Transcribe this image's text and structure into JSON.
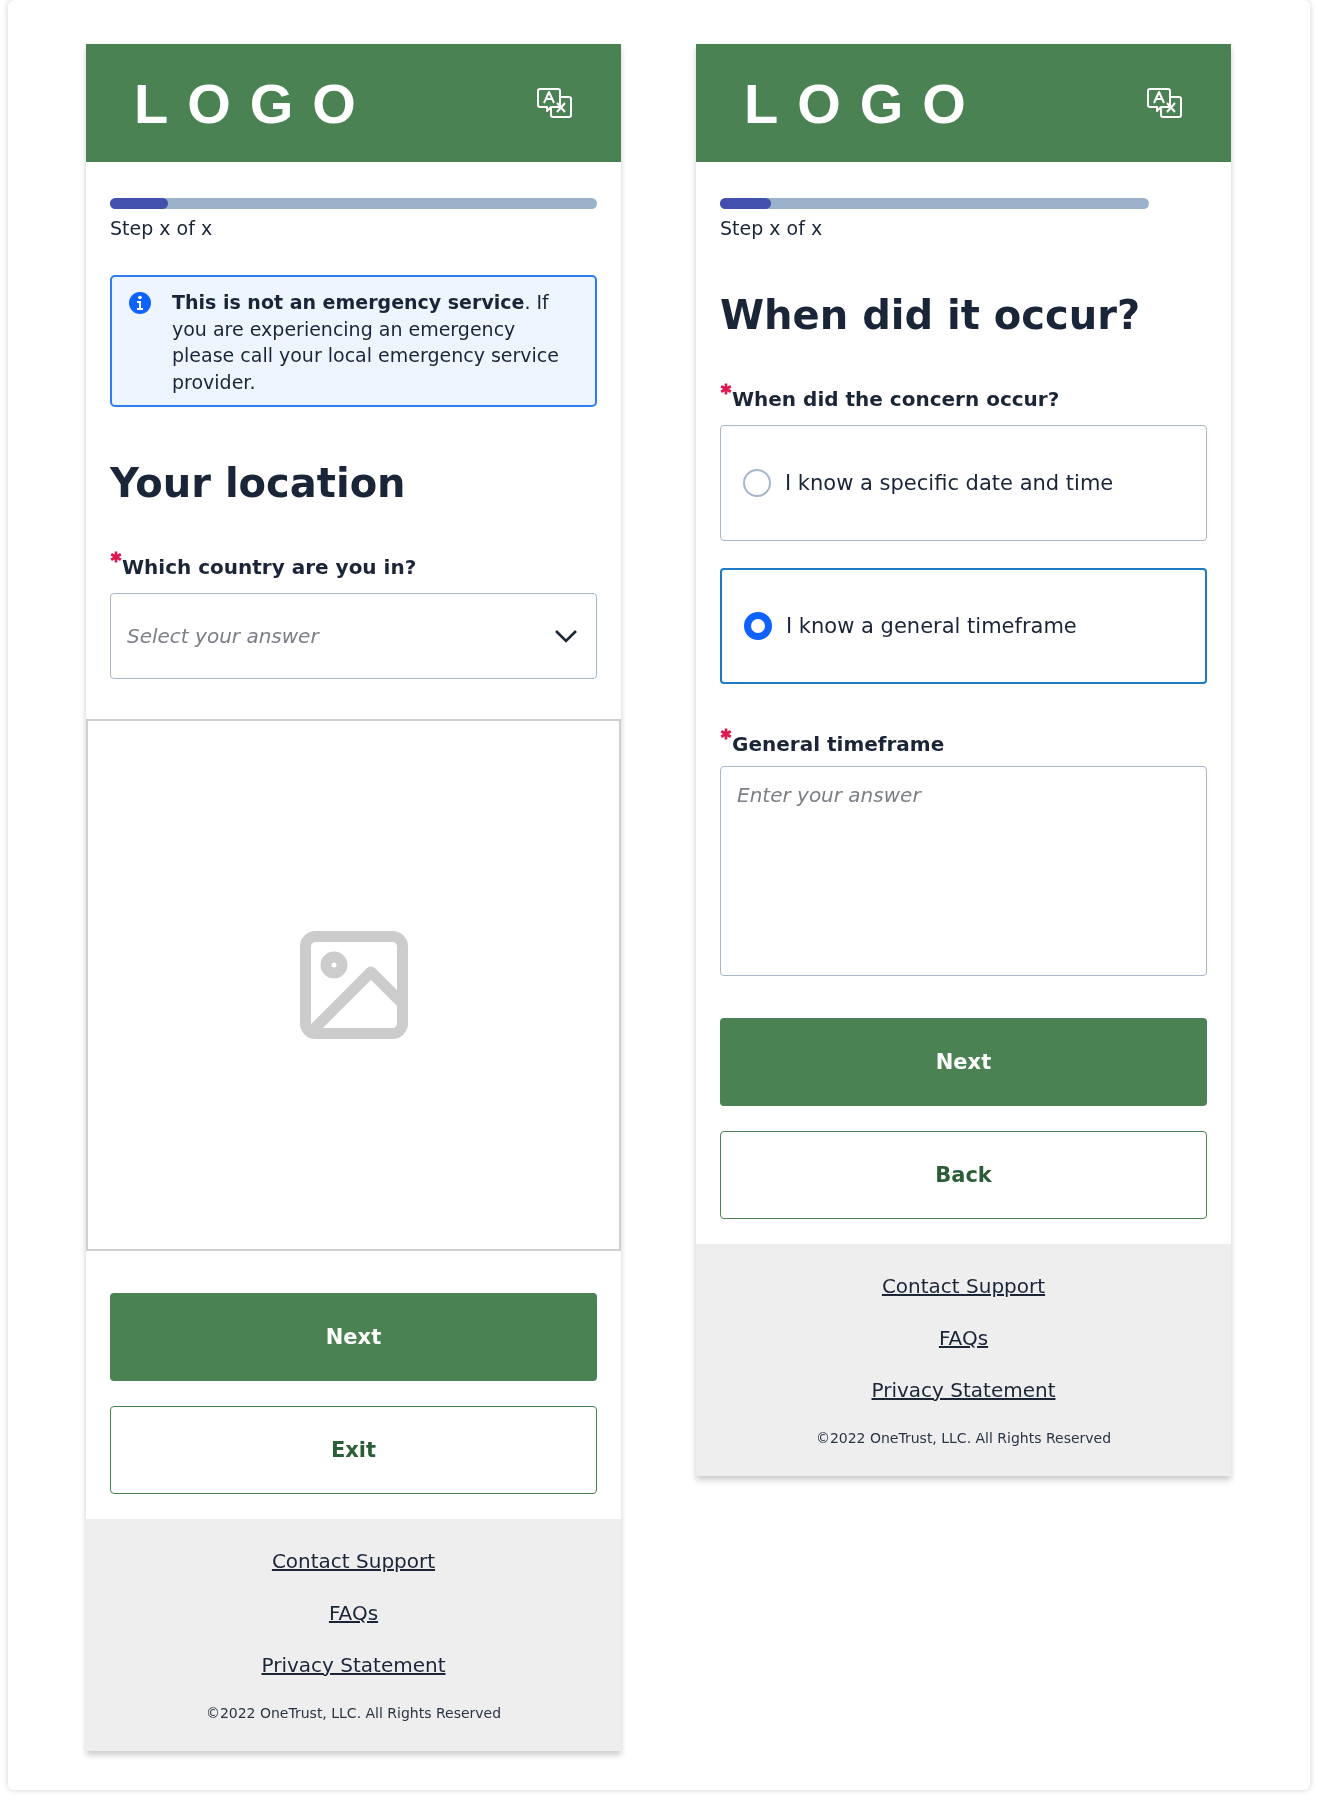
{
  "screens": [
    {
      "header": {
        "logo": "LOGO"
      },
      "progress": {
        "level": 0.12,
        "label": "Step x of x"
      },
      "blocks": [
        {
          "kind": "notice",
          "text": "**This is not an emergency service**. If you are experiencing an emergency please call your local emergency service provider."
        },
        {
          "kind": "heading",
          "text": "Your location"
        },
        {
          "kind": "select",
          "label": "Which country are you in?",
          "required": true,
          "placeholder": "Select your answer"
        },
        {
          "kind": "image"
        }
      ],
      "buttons": [
        {
          "label": "Next",
          "kind": "primary"
        },
        {
          "label": "Exit",
          "kind": "secondary"
        }
      ],
      "footer": {
        "links": [
          "Contact Support",
          "FAQs",
          "Privacy Statement"
        ],
        "copyright": "©2022 OneTrust, LLC. All Rights Reserved"
      }
    },
    {
      "header": {
        "logo": "LOGO"
      },
      "progress": {
        "level": 0.12,
        "label": "Step x of x"
      },
      "blocks": [
        {
          "kind": "heading",
          "text": "When did it occur?"
        },
        {
          "kind": "radio",
          "label": "When did the concern occur?",
          "required": true,
          "options": [
            {
              "label": "I know a specific date and time",
              "selected": false
            },
            {
              "label": "I know a general timeframe",
              "selected": true
            }
          ]
        },
        {
          "kind": "textarea",
          "label": "General timeframe",
          "required": true,
          "placeholder": "Enter your answer"
        }
      ],
      "buttons": [
        {
          "label": "Next",
          "kind": "primary"
        },
        {
          "label": "Back",
          "kind": "secondary"
        }
      ],
      "footer": {
        "links": [
          "Contact Support",
          "FAQs",
          "Privacy Statement"
        ],
        "copyright": "©2022 OneTrust, LLC. All Rights Reserved"
      }
    }
  ]
}
